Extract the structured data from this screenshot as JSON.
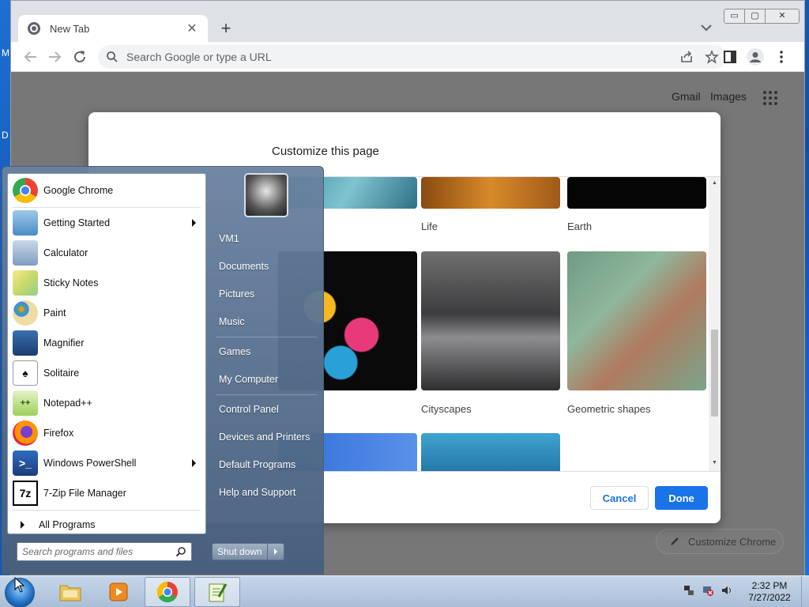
{
  "desktop": {
    "glyph_m": "M",
    "glyph_d": "D"
  },
  "browser": {
    "tab_title": "New Tab",
    "tab_close": "✕",
    "new_tab": "+",
    "window_controls": [
      "▭",
      "▢",
      "✕"
    ],
    "omnibox_placeholder": "Search Google or type a URL",
    "ntp": {
      "gmail": "Gmail",
      "images": "Images",
      "customize_chrome": "Customize Chrome"
    }
  },
  "dialog": {
    "title": "Customize this page",
    "tiles": [
      {
        "label": "Life"
      },
      {
        "label": "Earth"
      },
      {
        "label": "Cityscapes"
      },
      {
        "label": "Geometric shapes"
      }
    ],
    "cancel": "Cancel",
    "done": "Done"
  },
  "start_menu": {
    "programs": [
      {
        "label": "Google Chrome",
        "icon": "chrome-icon"
      },
      {
        "label": "Getting Started",
        "icon": "getting-started-icon",
        "submenu": true
      },
      {
        "label": "Calculator",
        "icon": "calculator-icon"
      },
      {
        "label": "Sticky Notes",
        "icon": "sticky-notes-icon"
      },
      {
        "label": "Paint",
        "icon": "paint-icon"
      },
      {
        "label": "Magnifier",
        "icon": "magnifier-icon"
      },
      {
        "label": "Solitaire",
        "icon": "solitaire-icon"
      },
      {
        "label": "Notepad++",
        "icon": "notepad-plus-plus-icon"
      },
      {
        "label": "Firefox",
        "icon": "firefox-icon"
      },
      {
        "label": "Windows PowerShell",
        "icon": "powershell-icon",
        "submenu": true
      },
      {
        "label": "7-Zip File Manager",
        "icon": "seven-zip-icon"
      }
    ],
    "all_programs": "All Programs",
    "search_placeholder": "Search programs and files",
    "right_links": [
      "VM1",
      "Documents",
      "Pictures",
      "Music",
      "Games",
      "My Computer",
      "Control Panel",
      "Devices and Printers",
      "Default Programs",
      "Help and Support"
    ],
    "shutdown": "Shut down"
  },
  "taskbar": {
    "clock_time": "2:32 PM",
    "clock_date": "7/27/2022"
  }
}
